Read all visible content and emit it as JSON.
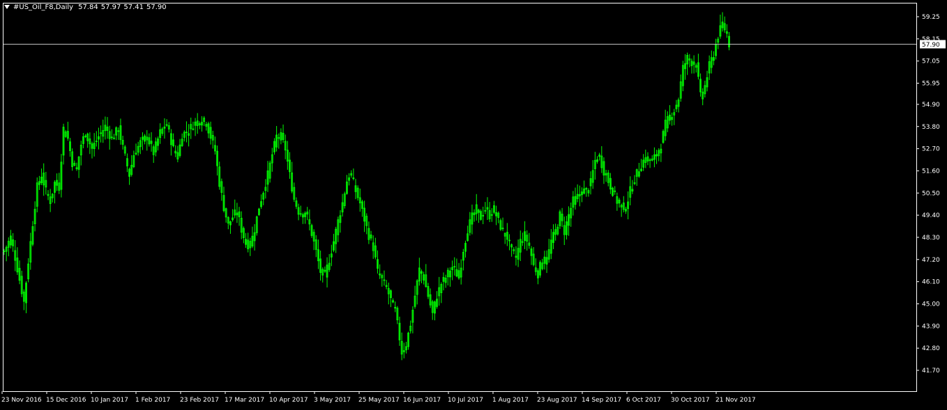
{
  "header": {
    "symbol": "#US_Oil_F8,Daily",
    "open": "57.84",
    "high": "57.97",
    "low": "57.41",
    "close": "57.90"
  },
  "colors": {
    "background": "#000000",
    "frame": "#ffffff",
    "candle": "#00ff00",
    "text": "#ffffff",
    "bid_line": "#c0c0c0"
  },
  "chart_data": {
    "type": "candlestick",
    "title": "#US_Oil_F8,Daily",
    "ylim": [
      41.2,
      59.9
    ],
    "yticks": [
      "59.25",
      "58.15",
      "57.05",
      "55.95",
      "54.90",
      "53.80",
      "52.70",
      "51.60",
      "50.50",
      "49.40",
      "48.30",
      "47.20",
      "46.10",
      "45.00",
      "43.90",
      "42.80",
      "41.70"
    ],
    "xticks": [
      "23 Nov 2016",
      "15 Dec 2016",
      "10 Jan 2017",
      "1 Feb 2017",
      "23 Feb 2017",
      "17 Mar 2017",
      "10 Apr 2017",
      "3 May 2017",
      "25 May 2017",
      "16 Jun 2017",
      "10 Jul 2017",
      "1 Aug 2017",
      "23 Aug 2017",
      "14 Sep 2017",
      "6 Oct 2017",
      "30 Oct 2017",
      "21 Nov 2017"
    ],
    "current_price": "57.90",
    "grid": false,
    "close_path": [
      [
        0,
        47.6
      ],
      [
        3,
        48.3
      ],
      [
        5,
        47.3
      ],
      [
        7,
        46.2
      ],
      [
        9,
        45.1
      ],
      [
        11,
        47.1
      ],
      [
        13,
        49.0
      ],
      [
        15,
        50.8
      ],
      [
        17,
        51.4
      ],
      [
        19,
        50.6
      ],
      [
        21,
        50.1
      ],
      [
        23,
        51.0
      ],
      [
        25,
        50.8
      ],
      [
        27,
        53.7
      ],
      [
        29,
        53.2
      ],
      [
        31,
        52.0
      ],
      [
        33,
        51.7
      ],
      [
        35,
        52.9
      ],
      [
        37,
        53.5
      ],
      [
        40,
        52.7
      ],
      [
        43,
        53.3
      ],
      [
        46,
        53.8
      ],
      [
        49,
        53.2
      ],
      [
        52,
        53.7
      ],
      [
        55,
        52.3
      ],
      [
        57,
        51.4
      ],
      [
        59,
        52.4
      ],
      [
        62,
        53.0
      ],
      [
        65,
        53.3
      ],
      [
        68,
        52.5
      ],
      [
        71,
        53.5
      ],
      [
        74,
        53.9
      ],
      [
        77,
        52.7
      ],
      [
        79,
        52.3
      ],
      [
        81,
        53.4
      ],
      [
        84,
        53.6
      ],
      [
        86,
        53.9
      ],
      [
        89,
        54.1
      ],
      [
        92,
        54.0
      ],
      [
        94,
        53.3
      ],
      [
        96,
        52.6
      ],
      [
        98,
        51.0
      ],
      [
        100,
        49.8
      ],
      [
        102,
        48.9
      ],
      [
        104,
        49.3
      ],
      [
        106,
        49.6
      ],
      [
        108,
        48.7
      ],
      [
        110,
        48.0
      ],
      [
        112,
        47.9
      ],
      [
        114,
        48.7
      ],
      [
        116,
        49.8
      ],
      [
        118,
        50.6
      ],
      [
        120,
        51.4
      ],
      [
        122,
        52.4
      ],
      [
        124,
        53.3
      ],
      [
        126,
        53.3
      ],
      [
        128,
        52.7
      ],
      [
        130,
        51.4
      ],
      [
        132,
        50.2
      ],
      [
        134,
        49.6
      ],
      [
        136,
        49.5
      ],
      [
        138,
        49.3
      ],
      [
        140,
        48.5
      ],
      [
        142,
        47.6
      ],
      [
        144,
        46.6
      ],
      [
        146,
        46.4
      ],
      [
        148,
        47.2
      ],
      [
        150,
        48.1
      ],
      [
        152,
        49.1
      ],
      [
        154,
        50.0
      ],
      [
        156,
        51.1
      ],
      [
        158,
        51.4
      ],
      [
        160,
        50.6
      ],
      [
        162,
        50.0
      ],
      [
        164,
        49.2
      ],
      [
        166,
        48.4
      ],
      [
        168,
        47.8
      ],
      [
        170,
        46.6
      ],
      [
        172,
        46.2
      ],
      [
        174,
        45.8
      ],
      [
        176,
        45.2
      ],
      [
        178,
        44.7
      ],
      [
        180,
        43.3
      ],
      [
        181,
        42.6
      ],
      [
        183,
        43.0
      ],
      [
        185,
        44.0
      ],
      [
        187,
        45.4
      ],
      [
        189,
        46.7
      ],
      [
        191,
        46.3
      ],
      [
        193,
        45.4
      ],
      [
        195,
        44.5
      ],
      [
        197,
        45.4
      ],
      [
        199,
        46.0
      ],
      [
        201,
        46.3
      ],
      [
        203,
        46.7
      ],
      [
        205,
        46.7
      ],
      [
        207,
        46.3
      ],
      [
        209,
        47.7
      ],
      [
        211,
        48.7
      ],
      [
        213,
        49.3
      ],
      [
        215,
        49.7
      ],
      [
        217,
        49.3
      ],
      [
        219,
        49.7
      ],
      [
        221,
        49.4
      ],
      [
        223,
        49.7
      ],
      [
        225,
        49.1
      ],
      [
        227,
        48.6
      ],
      [
        229,
        48.3
      ],
      [
        231,
        47.6
      ],
      [
        233,
        47.3
      ],
      [
        235,
        48.1
      ],
      [
        237,
        48.4
      ],
      [
        239,
        47.9
      ],
      [
        241,
        46.9
      ],
      [
        243,
        46.5
      ],
      [
        245,
        47.2
      ],
      [
        247,
        47.1
      ],
      [
        249,
        48.1
      ],
      [
        251,
        48.6
      ],
      [
        253,
        49.4
      ],
      [
        255,
        48.6
      ],
      [
        257,
        49.4
      ],
      [
        259,
        50.1
      ],
      [
        261,
        50.3
      ],
      [
        263,
        50.6
      ],
      [
        265,
        50.6
      ],
      [
        267,
        51.0
      ],
      [
        269,
        52.1
      ],
      [
        271,
        52.3
      ],
      [
        273,
        51.6
      ],
      [
        275,
        51.1
      ],
      [
        277,
        50.6
      ],
      [
        279,
        50.1
      ],
      [
        281,
        49.8
      ],
      [
        283,
        49.8
      ],
      [
        285,
        50.6
      ],
      [
        287,
        51.2
      ],
      [
        289,
        51.7
      ],
      [
        291,
        52.1
      ],
      [
        293,
        52.2
      ],
      [
        295,
        52.1
      ],
      [
        297,
        52.4
      ],
      [
        299,
        52.9
      ],
      [
        301,
        53.9
      ],
      [
        303,
        54.3
      ],
      [
        305,
        54.6
      ],
      [
        307,
        55.2
      ],
      [
        309,
        56.7
      ],
      [
        311,
        57.2
      ],
      [
        313,
        57.0
      ],
      [
        315,
        56.9
      ],
      [
        317,
        55.3
      ],
      [
        319,
        55.8
      ],
      [
        321,
        56.8
      ],
      [
        323,
        57.4
      ],
      [
        325,
        58.3
      ],
      [
        327,
        58.9
      ],
      [
        329,
        58.4
      ],
      [
        330,
        57.9
      ]
    ]
  }
}
